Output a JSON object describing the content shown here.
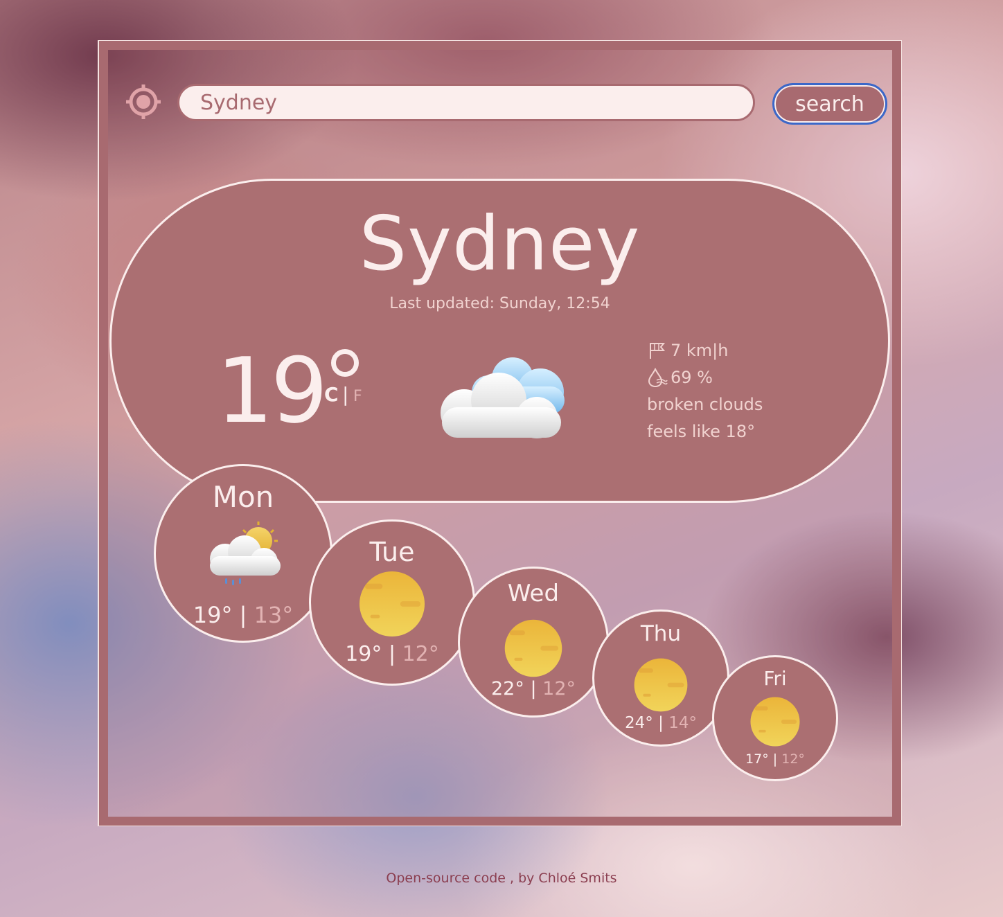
{
  "search": {
    "value": "Sydney",
    "button_label": "search"
  },
  "current": {
    "city": "Sydney",
    "last_updated": "Last updated: Sunday, 12:54",
    "temperature": "19",
    "unit_c": "C",
    "unit_separator": "|",
    "unit_f": "F",
    "icon": "broken-clouds-icon",
    "wind": "7 km|h",
    "humidity": "69 %",
    "description": "broken clouds",
    "feels_like": "feels like 18°"
  },
  "forecast": [
    {
      "day": "Mon",
      "high": "19°",
      "low": "13°",
      "icon": "cloud-sun-rain-icon"
    },
    {
      "day": "Tue",
      "high": "19°",
      "low": "12°",
      "icon": "sun-icon"
    },
    {
      "day": "Wed",
      "high": "22°",
      "low": "12°",
      "icon": "sun-icon"
    },
    {
      "day": "Thu",
      "high": "24°",
      "low": "14°",
      "icon": "sun-icon"
    },
    {
      "day": "Fri",
      "high": "17°",
      "low": "12°",
      "icon": "sun-icon"
    }
  ],
  "separator": "|",
  "footer": {
    "link": "Open-source code",
    "author": " , by Chloé Smits"
  },
  "colors": {
    "card": "#ab6f72",
    "cream": "#fbeeed",
    "muted": "#e2b3b3",
    "accent_border": "#3b68c9"
  }
}
